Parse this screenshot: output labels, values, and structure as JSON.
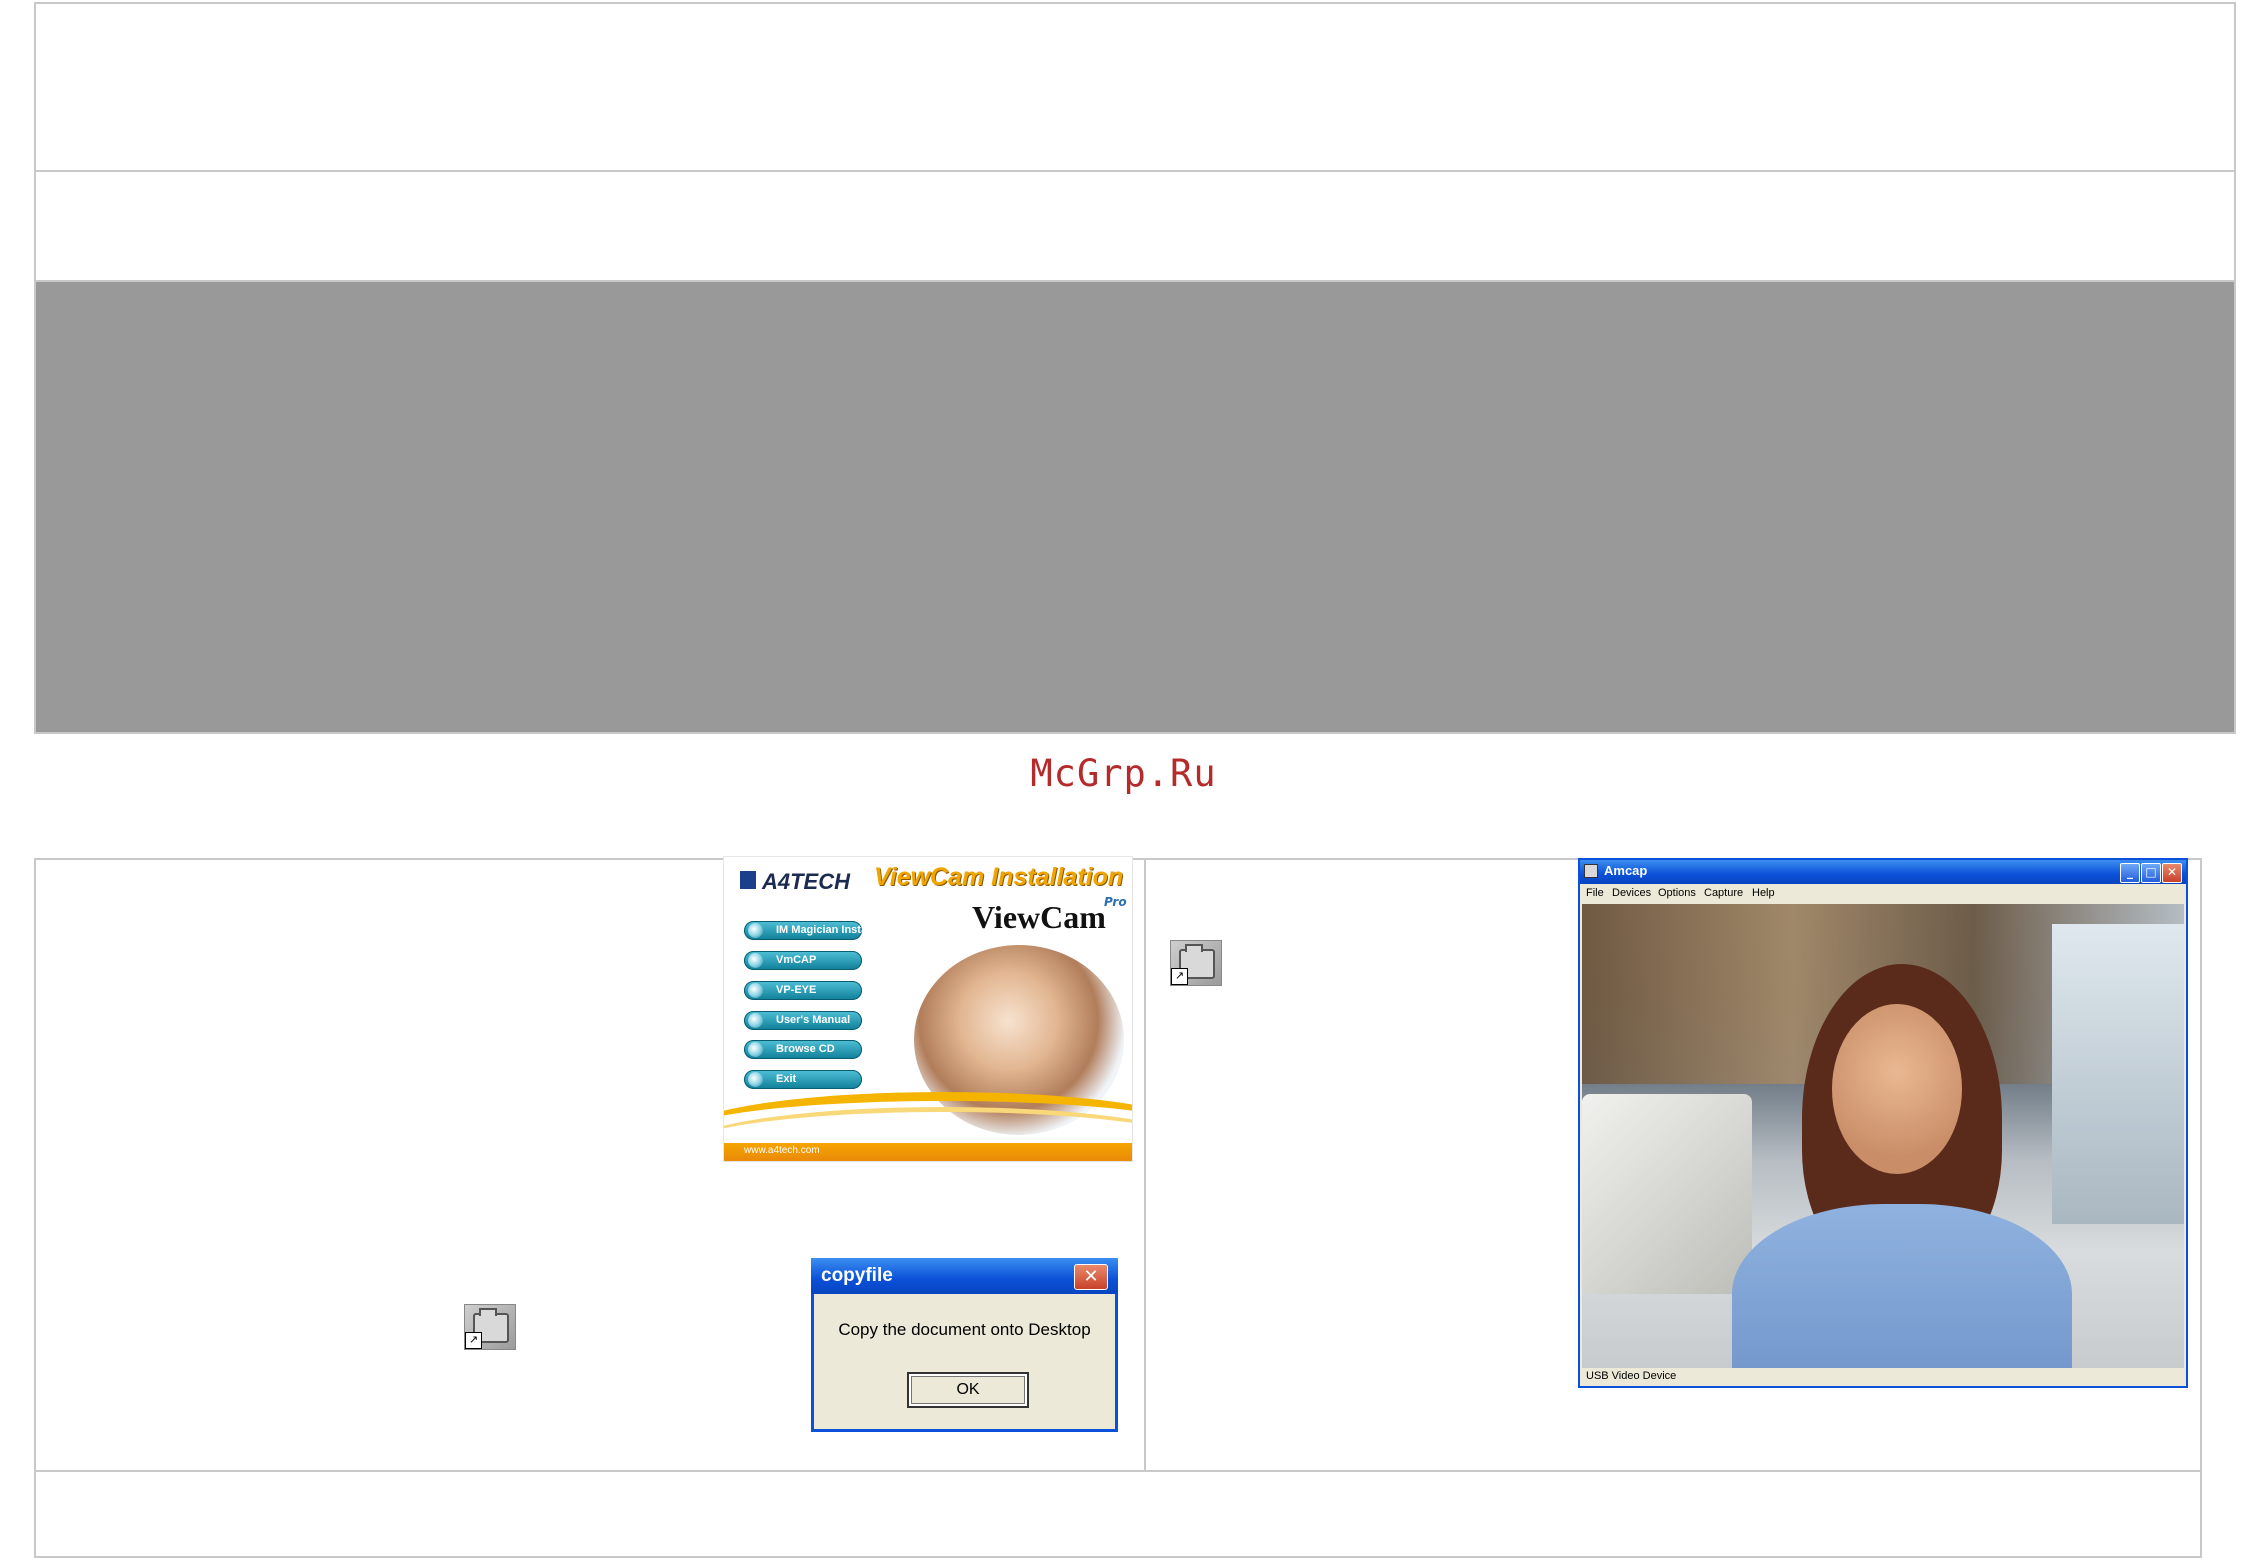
{
  "watermark": "McGrp.Ru",
  "installer": {
    "brand": "A4TECH",
    "title": "ViewCam Installation",
    "logo": "ViewCam",
    "logo_suffix": "Pro",
    "menu": [
      "IM Magician Install",
      "VmCAP",
      "VP-EYE",
      "User's Manual",
      "Browse CD",
      "Exit"
    ],
    "url": "www.a4tech.com"
  },
  "dialog": {
    "title": "copyfile",
    "close_glyph": "✕",
    "message": "Copy the document onto Desktop",
    "ok_label": "OK"
  },
  "amcap": {
    "title": "Amcap",
    "menu": [
      "File",
      "Devices",
      "Options",
      "Capture",
      "Help"
    ],
    "status": "USB Video Device",
    "min_glyph": "_",
    "max_glyph": "□",
    "close_glyph": "✕"
  },
  "icons": {
    "shortcut_arrow": "↗",
    "shortcut_icon_name": "camera-shortcut-icon"
  },
  "colors": {
    "watermark": "#b52a2a",
    "grey_band": "#999999",
    "xp_blue": "#0a50d8"
  }
}
